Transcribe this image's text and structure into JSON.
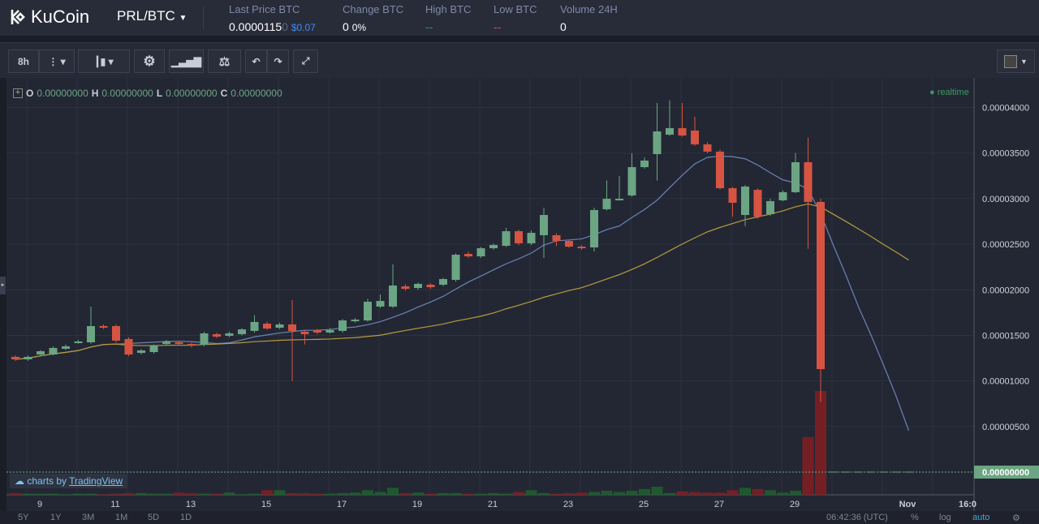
{
  "header": {
    "brand": "KuCoin",
    "pair": "PRL/BTC",
    "stats": [
      {
        "label": "Last Price BTC",
        "value": "0.0000115",
        "value_dim": "0",
        "extra": "$0.07"
      },
      {
        "label": "Change BTC",
        "value": "0",
        "extra": "0%"
      },
      {
        "label": "High BTC",
        "value": "--"
      },
      {
        "label": "Low BTC",
        "value": "--"
      },
      {
        "label": "Volume 24H",
        "value": "0"
      }
    ]
  },
  "toolbar": {
    "interval": "8h"
  },
  "legend": {
    "o_label": "O",
    "o": "0.00000000",
    "h_label": "H",
    "h": "0.00000000",
    "l_label": "L",
    "l": "0.00000000",
    "c_label": "C",
    "c": "0.00000000",
    "realtime": "realtime"
  },
  "watermark": {
    "prefix": "charts by",
    "brand": "TradingView"
  },
  "colors": {
    "up": "#6ba583",
    "down": "#d75442",
    "ma_fast": "#6a84b8",
    "ma_slow": "#b89b3e"
  },
  "chart_data": {
    "type": "candlestick",
    "unit": "satoshi (1e-8 BTC)",
    "price_ticks": [
      "0.00000000",
      "0.00000500",
      "0.00001000",
      "0.00001500",
      "0.00002000",
      "0.00002500",
      "0.00003000",
      "0.00003500",
      "0.00004000"
    ],
    "price_tick_values": [
      0,
      500,
      1000,
      1500,
      2000,
      2500,
      3000,
      3500,
      4000
    ],
    "current_price_label": "0.00000000",
    "date_labels": [
      "9",
      "11",
      "13",
      "15",
      "17",
      "19",
      "21",
      "23",
      "25",
      "27",
      "29",
      "Nov",
      "16:0"
    ],
    "candles": [
      [
        1264,
        1237,
        1280,
        1220
      ],
      [
        1237,
        1264,
        1280,
        1220
      ],
      [
        1290,
        1326,
        1340,
        1280
      ],
      [
        1290,
        1362,
        1380,
        1280
      ],
      [
        1353,
        1380,
        1400,
        1340
      ],
      [
        1424,
        1433,
        1450,
        1410
      ],
      [
        1424,
        1602,
        1816,
        1410
      ],
      [
        1602,
        1593,
        1620,
        1570
      ],
      [
        1602,
        1442,
        1620,
        1420
      ],
      [
        1460,
        1290,
        1480,
        1270
      ],
      [
        1308,
        1335,
        1350,
        1290
      ],
      [
        1317,
        1388,
        1400,
        1300
      ],
      [
        1406,
        1433,
        1450,
        1390
      ],
      [
        1424,
        1406,
        1440,
        1390
      ],
      [
        1406,
        1388,
        1420,
        1370
      ],
      [
        1397,
        1522,
        1540,
        1380
      ],
      [
        1513,
        1486,
        1530,
        1470
      ],
      [
        1495,
        1522,
        1540,
        1480
      ],
      [
        1513,
        1566,
        1580,
        1500
      ],
      [
        1549,
        1647,
        1720,
        1530
      ],
      [
        1629,
        1575,
        1650,
        1560
      ],
      [
        1584,
        1620,
        1640,
        1570
      ],
      [
        1620,
        1549,
        1887,
        1000
      ],
      [
        1540,
        1513,
        1560,
        1400
      ],
      [
        1558,
        1531,
        1570,
        1510
      ],
      [
        1531,
        1558,
        1580,
        1520
      ],
      [
        1549,
        1664,
        1680,
        1530
      ],
      [
        1655,
        1673,
        1690,
        1640
      ],
      [
        1664,
        1869,
        1900,
        1650
      ],
      [
        1816,
        1878,
        1950,
        1800
      ],
      [
        1816,
        2047,
        2279,
        1800
      ],
      [
        2038,
        2011,
        2060,
        1990
      ],
      [
        2020,
        2065,
        2080,
        2000
      ],
      [
        2056,
        2029,
        2070,
        2010
      ],
      [
        2056,
        2118,
        2130,
        2040
      ],
      [
        2109,
        2385,
        2400,
        2090
      ],
      [
        2394,
        2367,
        2420,
        2350
      ],
      [
        2367,
        2456,
        2470,
        2350
      ],
      [
        2456,
        2492,
        2510,
        2440
      ],
      [
        2483,
        2643,
        2680,
        2470
      ],
      [
        2643,
        2510,
        2660,
        2490
      ],
      [
        2510,
        2625,
        2650,
        2490
      ],
      [
        2599,
        2821,
        2900,
        2350
      ],
      [
        2599,
        2536,
        2620,
        2480
      ],
      [
        2536,
        2474,
        2550,
        2460
      ],
      [
        2474,
        2465,
        2490,
        2440
      ],
      [
        2465,
        2875,
        2900,
        2420
      ],
      [
        2884,
        2999,
        3200,
        2870
      ],
      [
        2990,
        2999,
        3250,
        2980
      ],
      [
        3035,
        3346,
        3500,
        3020
      ],
      [
        3346,
        3418,
        3450,
        3330
      ],
      [
        3489,
        3738,
        4050,
        3200
      ],
      [
        3702,
        3774,
        4080,
        3690
      ],
      [
        3774,
        3693,
        4050,
        3680
      ],
      [
        3747,
        3596,
        3900,
        3580
      ],
      [
        3596,
        3516,
        3620,
        3500
      ],
      [
        3516,
        3115,
        3540,
        3100
      ],
      [
        3115,
        2955,
        3130,
        2800
      ],
      [
        2821,
        3133,
        3150,
        2700
      ],
      [
        3097,
        2804,
        3110,
        2780
      ],
      [
        2830,
        2973,
        3000,
        2810
      ],
      [
        2982,
        3071,
        3090,
        2970
      ],
      [
        3071,
        3400,
        3500,
        3060
      ],
      [
        3400,
        2964,
        3670,
        2450
      ],
      [
        2964,
        1130,
        3000,
        770
      ],
      [
        0,
        0,
        0,
        0
      ],
      [
        0,
        0,
        0,
        0
      ],
      [
        0,
        0,
        0,
        0
      ],
      [
        0,
        0,
        0,
        0
      ],
      [
        0,
        0,
        0,
        0
      ],
      [
        0,
        0,
        0,
        0
      ],
      [
        0,
        0,
        0,
        0
      ]
    ],
    "volume": [
      3,
      2,
      2,
      2,
      1,
      2,
      2,
      1,
      2,
      3,
      3,
      2,
      2,
      4,
      3,
      2,
      2,
      4,
      1,
      2,
      8,
      8,
      3,
      3,
      2,
      2,
      3,
      4,
      8,
      5,
      12,
      3,
      4,
      2,
      3,
      3,
      2,
      2,
      3,
      2,
      5,
      8,
      3,
      2,
      3,
      4,
      5,
      7,
      5,
      7,
      10,
      14,
      3,
      6,
      5,
      4,
      4,
      8,
      12,
      10,
      8,
      4,
      7,
      100,
      180,
      0,
      0,
      0,
      0,
      0,
      0,
      0
    ],
    "ma_periods": [
      9,
      30
    ]
  }
}
